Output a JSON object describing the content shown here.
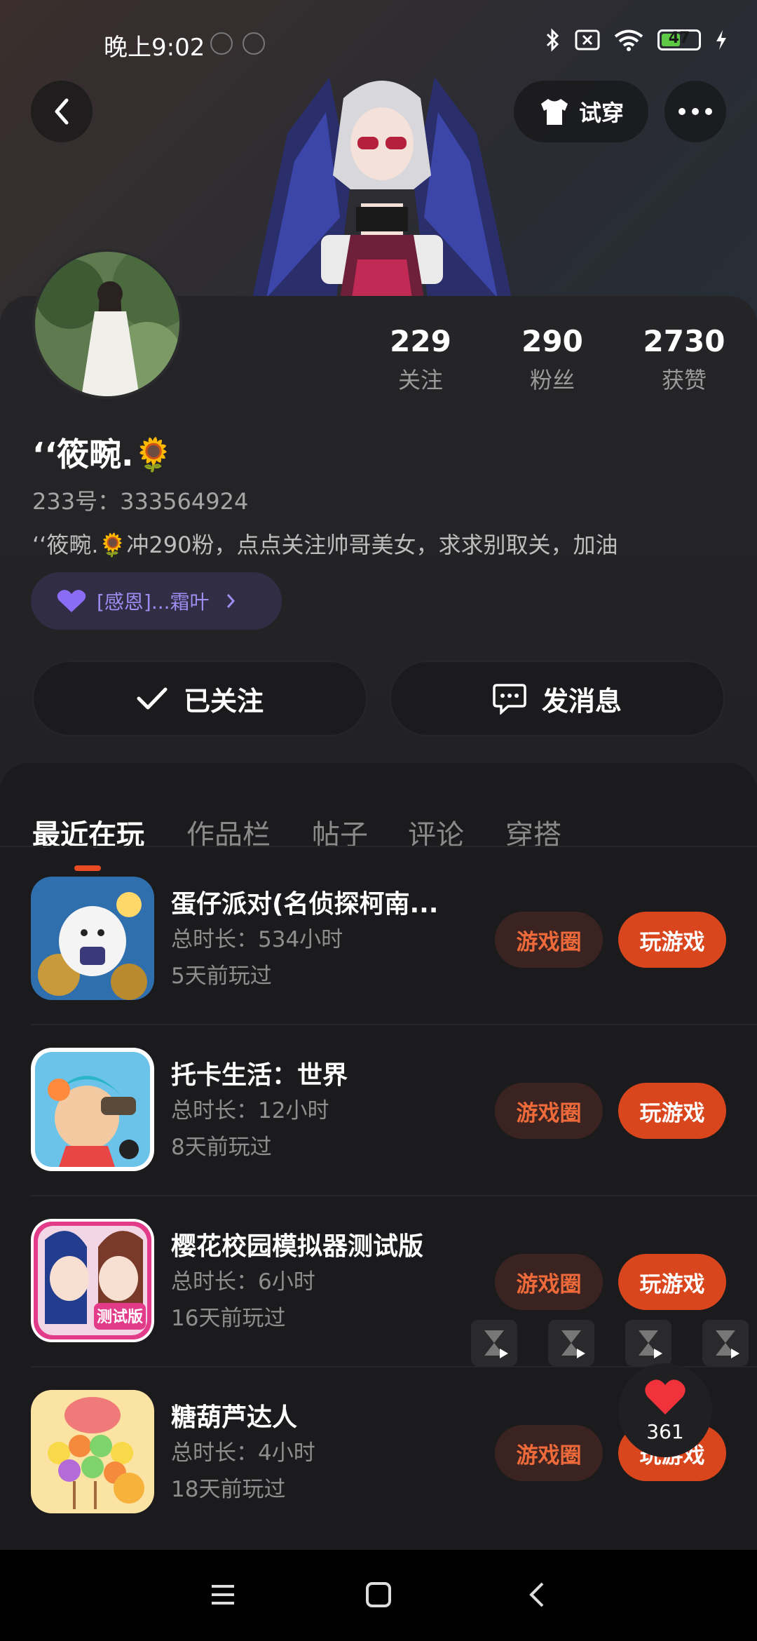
{
  "status_bar": {
    "time": "晚上9:02",
    "battery": "47",
    "icons": [
      "notification-icon",
      "notification-icon",
      "bluetooth-icon",
      "sim-off-icon",
      "wifi-icon",
      "battery-icon",
      "charging-icon"
    ]
  },
  "header": {
    "back_icon": "back-arrow-icon",
    "try_on_label": "试穿",
    "more_icon": "more-dots-icon"
  },
  "profile": {
    "nickname": "‘‘筱畹.🌻",
    "uid": "233号：333564924",
    "bio": "‘‘筱畹.🌻冲290粉，点点关注帅哥美女，求求别取关，加油",
    "tag_chip": "[感恩]...霜叶",
    "stats": [
      {
        "value": "229",
        "label": "关注"
      },
      {
        "value": "290",
        "label": "粉丝"
      },
      {
        "value": "2730",
        "label": "获赞"
      }
    ],
    "follow_label": "已关注",
    "message_label": "发消息"
  },
  "tabs": [
    {
      "label": "最近在玩",
      "active": true
    },
    {
      "label": "作品栏",
      "active": false
    },
    {
      "label": "帖子",
      "active": false
    },
    {
      "label": "评论",
      "active": false
    },
    {
      "label": "穿搭",
      "active": false
    }
  ],
  "games": [
    {
      "title": "蛋仔派对(名侦探柯南...",
      "duration": "总时长：534小时",
      "last_played": "5天前玩过",
      "circle_label": "游戏圈",
      "play_label": "玩游戏"
    },
    {
      "title": "托卡生活：世界",
      "duration": "总时长：12小时",
      "last_played": "8天前玩过",
      "circle_label": "游戏圈",
      "play_label": "玩游戏"
    },
    {
      "title": "樱花校园模拟器测试版",
      "duration": "总时长：6小时",
      "last_played": "16天前玩过",
      "circle_label": "游戏圈",
      "play_label": "玩游戏"
    },
    {
      "title": "糖葫芦达人",
      "duration": "总时长：4小时",
      "last_played": "18天前玩过",
      "circle_label": "游戏圈",
      "play_label": "玩游戏"
    }
  ],
  "floating_like": {
    "count": "361",
    "icon": "heart-icon"
  },
  "nav_bar": {
    "icons": [
      "menu-icon",
      "home-square-icon",
      "back-chevron-icon"
    ]
  },
  "colors": {
    "accent": "#d9451c",
    "accent_text": "#ee6a3a",
    "chip": "#312d45",
    "chip_text": "#9f8cf0",
    "battery": "#5ec944"
  }
}
